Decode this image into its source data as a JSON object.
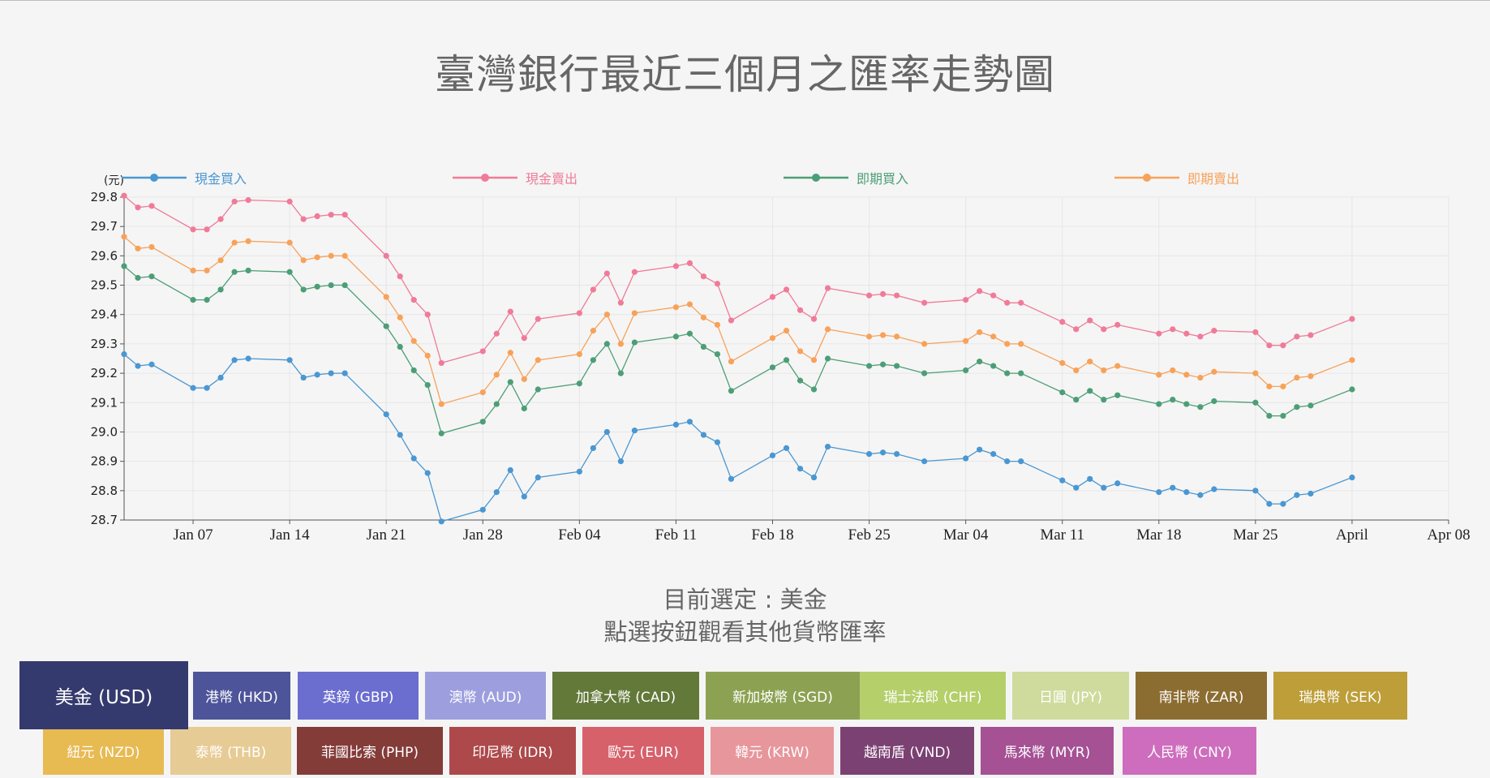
{
  "page": {
    "title": "臺灣銀行最近三個月之匯率走勢圖"
  },
  "selection": {
    "current_label": "目前選定 : 美金",
    "hint": "點選按鈕觀看其他貨幣匯率"
  },
  "buttons": [
    {
      "label": "美金 (USD)",
      "color": "#353a6e",
      "active": true
    },
    {
      "label": "港幣 (HKD)",
      "color": "#4d5499"
    },
    {
      "label": "英鎊 (GBP)",
      "color": "#6b6ecf"
    },
    {
      "label": "澳幣 (AUD)",
      "color": "#9c9ede"
    },
    {
      "label": "加拿大幣 (CAD)",
      "color": "#637939"
    },
    {
      "label": "新加坡幣 (SGD)",
      "color": "#8ca252"
    },
    {
      "label": "瑞士法郎 (CHF)",
      "color": "#b5cf6b"
    },
    {
      "label": "日圓 (JPY)",
      "color": "#cedb9c"
    },
    {
      "label": "南非幣 (ZAR)",
      "color": "#8c6d31"
    },
    {
      "label": "瑞典幣 (SEK)",
      "color": "#bd9e39"
    },
    {
      "label": "紐元 (NZD)",
      "color": "#e7ba52"
    },
    {
      "label": "泰幣 (THB)",
      "color": "#e7cb94"
    },
    {
      "label": "菲國比索 (PHP)",
      "color": "#843c39"
    },
    {
      "label": "印尼幣 (IDR)",
      "color": "#ad494a"
    },
    {
      "label": "歐元 (EUR)",
      "color": "#d6616b"
    },
    {
      "label": "韓元 (KRW)",
      "color": "#e7969c"
    },
    {
      "label": "越南盾 (VND)",
      "color": "#7b4173"
    },
    {
      "label": "馬來幣 (MYR)",
      "color": "#a55194"
    },
    {
      "label": "人民幣 (CNY)",
      "color": "#ce6dbd"
    }
  ],
  "chart_data": {
    "type": "line",
    "title": "臺灣銀行最近三個月之匯率走勢圖",
    "ylabel": "(元)",
    "xlabel": "",
    "ylim": [
      28.7,
      29.8
    ],
    "yticks": [
      "29.8",
      "29.7",
      "29.6",
      "29.5",
      "29.4",
      "29.3",
      "29.2",
      "29.1",
      "29.0",
      "28.9",
      "28.8",
      "28.7"
    ],
    "grid": true,
    "legend_position": "top",
    "x_tick_labels": [
      "Jan 07",
      "Jan 14",
      "Jan 21",
      "Jan 28",
      "Feb 04",
      "Feb 11",
      "Feb 18",
      "Feb 25",
      "Mar 04",
      "Mar 11",
      "Mar 18",
      "Mar 25",
      "April",
      "Apr 08"
    ],
    "x_tick_dates": [
      "2019-01-07",
      "2019-01-14",
      "2019-01-21",
      "2019-01-28",
      "2019-02-04",
      "2019-02-11",
      "2019-02-18",
      "2019-02-25",
      "2019-03-04",
      "2019-03-11",
      "2019-03-18",
      "2019-03-25",
      "2019-04-01",
      "2019-04-08"
    ],
    "x": [
      "2019-01-02",
      "2019-01-03",
      "2019-01-04",
      "2019-01-07",
      "2019-01-08",
      "2019-01-09",
      "2019-01-10",
      "2019-01-11",
      "2019-01-14",
      "2019-01-15",
      "2019-01-16",
      "2019-01-17",
      "2019-01-18",
      "2019-01-21",
      "2019-01-22",
      "2019-01-23",
      "2019-01-24",
      "2019-01-25",
      "2019-01-28",
      "2019-01-29",
      "2019-01-30",
      "2019-01-31",
      "2019-02-01",
      "2019-02-04",
      "2019-02-05",
      "2019-02-06",
      "2019-02-07",
      "2019-02-08",
      "2019-02-11",
      "2019-02-12",
      "2019-02-13",
      "2019-02-14",
      "2019-02-15",
      "2019-02-18",
      "2019-02-19",
      "2019-02-20",
      "2019-02-21",
      "2019-02-22",
      "2019-02-25",
      "2019-02-26",
      "2019-02-27",
      "2019-03-01",
      "2019-03-04",
      "2019-03-05",
      "2019-03-06",
      "2019-03-07",
      "2019-03-08",
      "2019-03-11",
      "2019-03-12",
      "2019-03-13",
      "2019-03-14",
      "2019-03-15",
      "2019-03-18",
      "2019-03-19",
      "2019-03-20",
      "2019-03-21",
      "2019-03-22",
      "2019-03-25",
      "2019-03-26",
      "2019-03-27",
      "2019-03-28",
      "2019-03-29",
      "2019-04-01",
      "2019-04-02",
      "2019-04-03",
      "2019-04-04",
      "2019-04-05",
      "2019-04-08"
    ],
    "series": [
      {
        "name": "現金買入",
        "color": "#4a97d2",
        "values": [
          29.265,
          29.225,
          29.23,
          29.15,
          29.15,
          29.185,
          29.245,
          29.25,
          29.245,
          29.185,
          29.195,
          29.2,
          29.2,
          29.06,
          28.99,
          28.91,
          28.86,
          28.695,
          28.735,
          28.795,
          28.87,
          28.78,
          28.845,
          28.865,
          28.945,
          29.0,
          28.9,
          29.005,
          29.025,
          29.035,
          28.99,
          28.965,
          28.84,
          28.92,
          28.945,
          28.875,
          28.845,
          28.95,
          28.925,
          28.93,
          28.925,
          28.9,
          28.91,
          28.94,
          28.925,
          28.9,
          28.9,
          28.835,
          28.81,
          28.84,
          28.81,
          28.825,
          28.795,
          28.81,
          28.795,
          28.785,
          28.805,
          28.8,
          28.755,
          28.755,
          28.785,
          28.79,
          28.845
        ]
      },
      {
        "name": "現金賣出",
        "color": "#f07b98",
        "values": [
          29.805,
          29.765,
          29.77,
          29.69,
          29.69,
          29.725,
          29.785,
          29.79,
          29.785,
          29.725,
          29.735,
          29.74,
          29.74,
          29.6,
          29.53,
          29.45,
          29.4,
          29.235,
          29.275,
          29.335,
          29.41,
          29.32,
          29.385,
          29.405,
          29.485,
          29.54,
          29.44,
          29.545,
          29.565,
          29.575,
          29.53,
          29.505,
          29.38,
          29.46,
          29.485,
          29.415,
          29.385,
          29.49,
          29.465,
          29.47,
          29.465,
          29.44,
          29.45,
          29.48,
          29.465,
          29.44,
          29.44,
          29.375,
          29.35,
          29.38,
          29.35,
          29.365,
          29.335,
          29.35,
          29.335,
          29.325,
          29.345,
          29.34,
          29.295,
          29.295,
          29.325,
          29.33,
          29.385
        ]
      },
      {
        "name": "即期買入",
        "color": "#4d9e77",
        "values": [
          29.565,
          29.525,
          29.53,
          29.45,
          29.45,
          29.485,
          29.545,
          29.55,
          29.545,
          29.485,
          29.495,
          29.5,
          29.5,
          29.36,
          29.29,
          29.21,
          29.16,
          28.995,
          29.035,
          29.095,
          29.17,
          29.08,
          29.145,
          29.165,
          29.245,
          29.3,
          29.2,
          29.305,
          29.325,
          29.335,
          29.29,
          29.265,
          29.14,
          29.22,
          29.245,
          29.175,
          29.145,
          29.25,
          29.225,
          29.23,
          29.225,
          29.2,
          29.21,
          29.24,
          29.225,
          29.2,
          29.2,
          29.135,
          29.11,
          29.14,
          29.11,
          29.125,
          29.095,
          29.11,
          29.095,
          29.085,
          29.105,
          29.1,
          29.055,
          29.055,
          29.085,
          29.09,
          29.145
        ]
      },
      {
        "name": "即期賣出",
        "color": "#f7a25a",
        "values": [
          29.665,
          29.625,
          29.63,
          29.55,
          29.55,
          29.585,
          29.645,
          29.65,
          29.645,
          29.585,
          29.595,
          29.6,
          29.6,
          29.46,
          29.39,
          29.31,
          29.26,
          29.095,
          29.135,
          29.195,
          29.27,
          29.18,
          29.245,
          29.265,
          29.345,
          29.4,
          29.3,
          29.405,
          29.425,
          29.435,
          29.39,
          29.365,
          29.24,
          29.32,
          29.345,
          29.275,
          29.245,
          29.35,
          29.325,
          29.33,
          29.325,
          29.3,
          29.31,
          29.34,
          29.325,
          29.3,
          29.3,
          29.235,
          29.21,
          29.24,
          29.21,
          29.225,
          29.195,
          29.21,
          29.195,
          29.185,
          29.205,
          29.2,
          29.155,
          29.155,
          29.185,
          29.19,
          29.245
        ]
      }
    ]
  }
}
